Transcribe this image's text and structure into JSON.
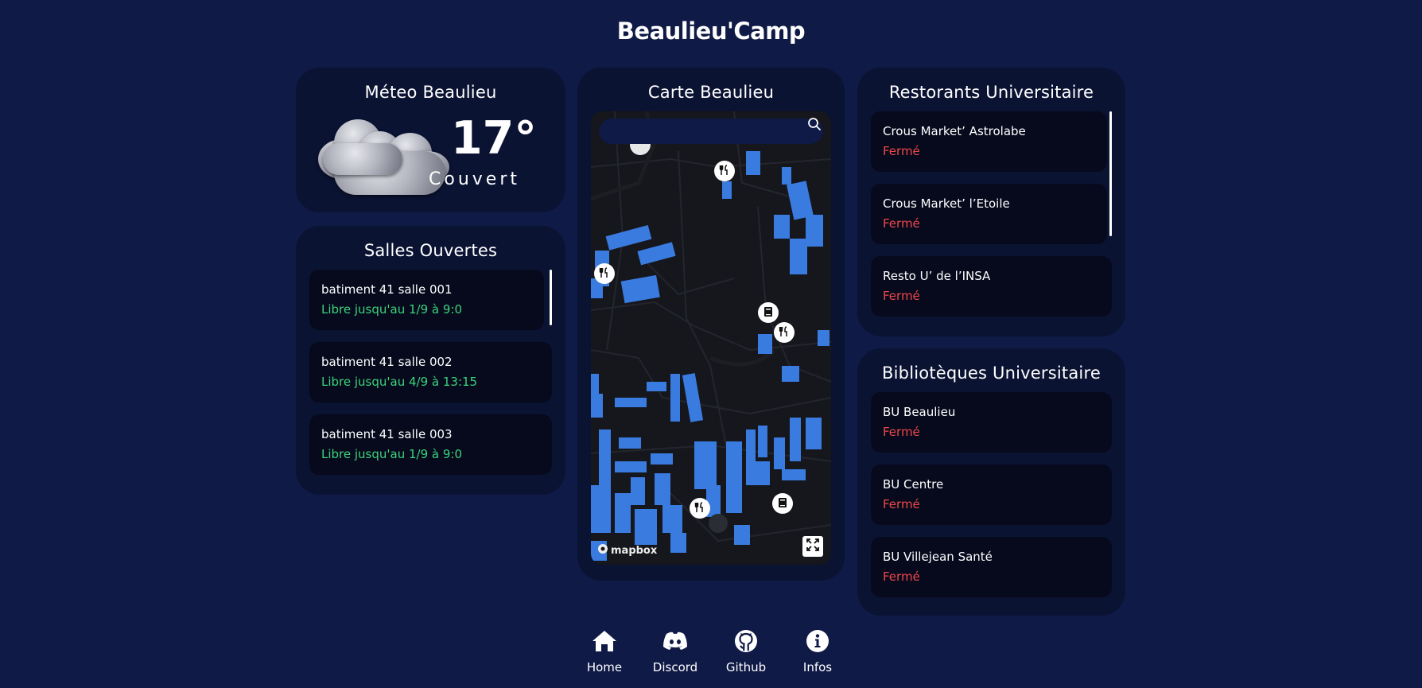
{
  "app": {
    "title": "Beaulieu'Camp"
  },
  "weather": {
    "title": "Méteo Beaulieu",
    "temperature": "17°",
    "condition": "Couvert",
    "icon": "clouds-icon"
  },
  "rooms": {
    "title": "Salles Ouvertes",
    "items": [
      {
        "name": "batiment 41 salle 001",
        "status": "Libre jusqu'au 1/9 à 9:0"
      },
      {
        "name": "batiment 41 salle 002",
        "status": "Libre jusqu'au 4/9 à 13:15"
      },
      {
        "name": "batiment 41 salle 003",
        "status": "Libre jusqu'au 1/9 à 9:0"
      }
    ]
  },
  "map": {
    "title": "Carte Beaulieu",
    "search_placeholder": "",
    "attribution": "mapbox"
  },
  "restaurants": {
    "title": "Restorants Universitaire",
    "items": [
      {
        "name": "Crous Market’ Astrolabe",
        "status": "Fermé"
      },
      {
        "name": "Crous Market’ l’Etoile",
        "status": "Fermé"
      },
      {
        "name": "Resto U’ de l’INSA",
        "status": "Fermé"
      }
    ]
  },
  "libraries": {
    "title": "Bibliotèques Universitaire",
    "items": [
      {
        "name": "BU Beaulieu",
        "status": "Fermé"
      },
      {
        "name": "BU Centre",
        "status": "Fermé"
      },
      {
        "name": "BU Villejean Santé",
        "status": "Fermé"
      }
    ]
  },
  "nav": {
    "home": "Home",
    "discord": "Discord",
    "github": "Github",
    "infos": "Infos"
  },
  "colors": {
    "background": "#0f1a46",
    "card": "#0b1333",
    "item": "#070a1d",
    "open": "#3bd37a",
    "closed": "#f04747",
    "building": "#3a7be0"
  }
}
